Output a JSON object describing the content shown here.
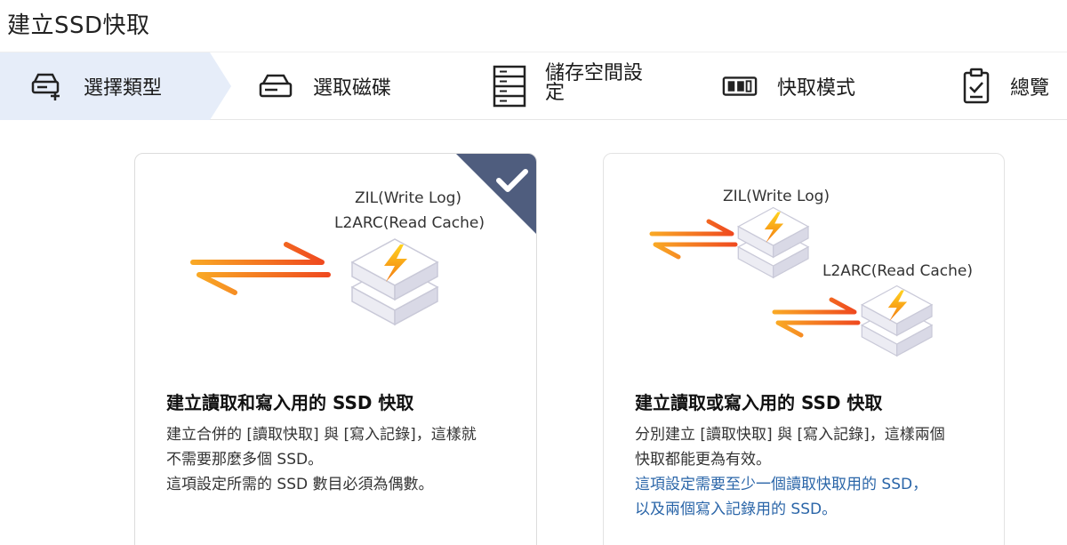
{
  "page": {
    "title": "建立SSD快取"
  },
  "steps": [
    {
      "label": "選擇類型",
      "icon": "ssd-add-icon",
      "active": true
    },
    {
      "label": "選取磁碟",
      "icon": "disk-icon",
      "active": false
    },
    {
      "label": "儲存空間設定",
      "icon": "storage-rack-icon",
      "active": false
    },
    {
      "label": "快取模式",
      "icon": "cache-mode-icon",
      "active": false
    },
    {
      "label": "總覽",
      "icon": "clipboard-check-icon",
      "active": false
    }
  ],
  "cards": [
    {
      "selected": true,
      "illustration": {
        "label_1": "ZIL(Write Log)",
        "label_2": "L2ARC(Read Cache)"
      },
      "title": "建立讀取和寫入用的 SSD 快取",
      "desc_1": "建立合併的 [讀取快取] 與 [寫入記錄]，這樣就",
      "desc_2": "不需要那麼多個 SSD。",
      "desc_3": "這項設定所需的 SSD 數目必須為偶數。"
    },
    {
      "selected": false,
      "illustration": {
        "label_1": "ZIL(Write Log)",
        "label_2": "L2ARC(Read Cache)"
      },
      "title": "建立讀取或寫入用的 SSD 快取",
      "desc_1": "分別建立 [讀取快取] 與 [寫入記錄]，這樣兩個",
      "desc_2": "快取都能更為有效。",
      "note_1": "這項設定需要至少一個讀取快取用的 SSD，",
      "note_2": "以及兩個寫入記錄用的 SSD。"
    }
  ],
  "colors": {
    "accent_blue": "#2a65a8",
    "active_step_bg": "#e6edf9",
    "badge": "#4f5d7e",
    "arrow_orange": "#f26b1d"
  }
}
